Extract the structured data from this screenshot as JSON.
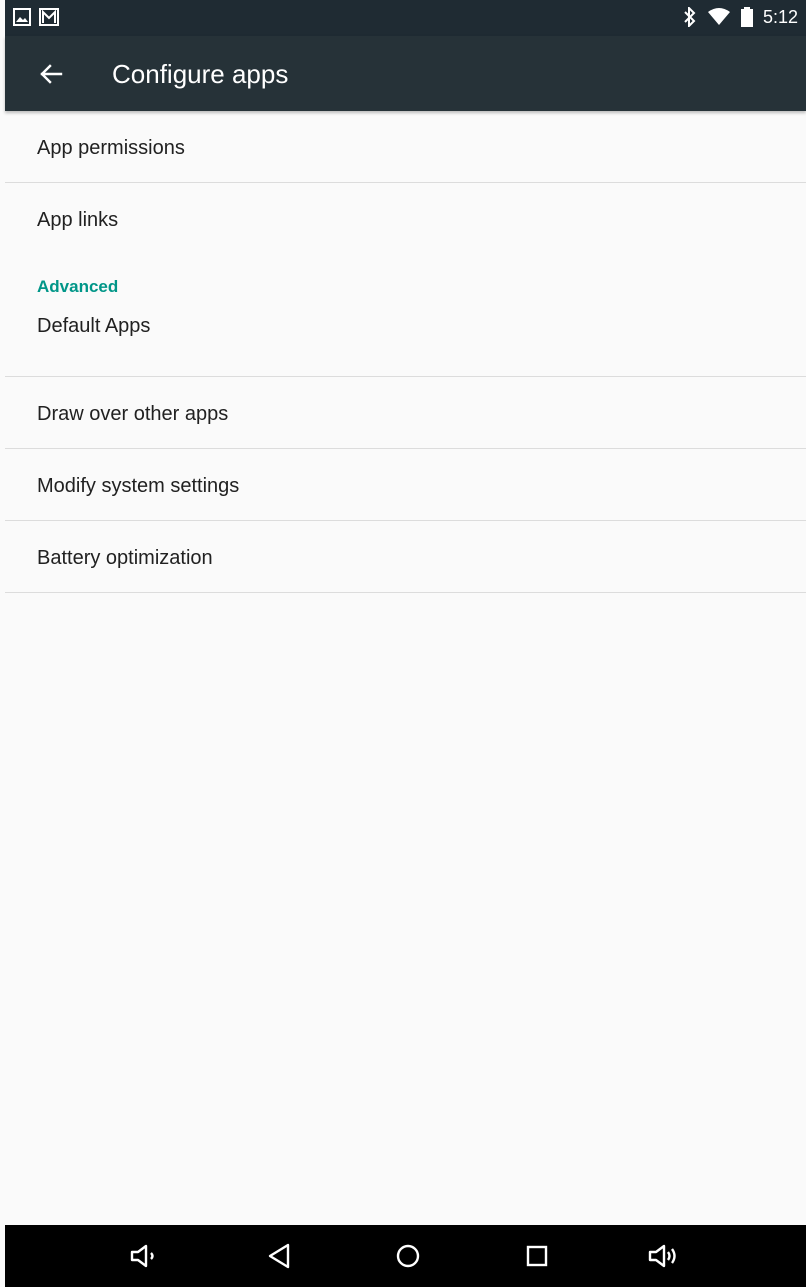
{
  "status_bar": {
    "time": "5:12",
    "left_icons": [
      "image-icon",
      "gmail-icon"
    ],
    "right_icons": [
      "bluetooth-icon",
      "wifi-icon",
      "battery-icon"
    ]
  },
  "toolbar": {
    "title": "Configure apps",
    "back_icon": "arrow-back-icon"
  },
  "list": {
    "item1": "App permissions",
    "item2": "App links",
    "advanced_header": "Advanced",
    "item3": "Default Apps",
    "item4": "Draw over other apps",
    "item5": "Modify system settings",
    "item6": "Battery optimization"
  },
  "nav_bar": {
    "buttons": [
      "volume-down-icon",
      "back-icon",
      "home-icon",
      "recents-icon",
      "volume-up-icon"
    ]
  },
  "colors": {
    "toolbar": "#263238",
    "status_bar": "#1f2b33",
    "accent": "#009688",
    "background": "#fafafa"
  }
}
